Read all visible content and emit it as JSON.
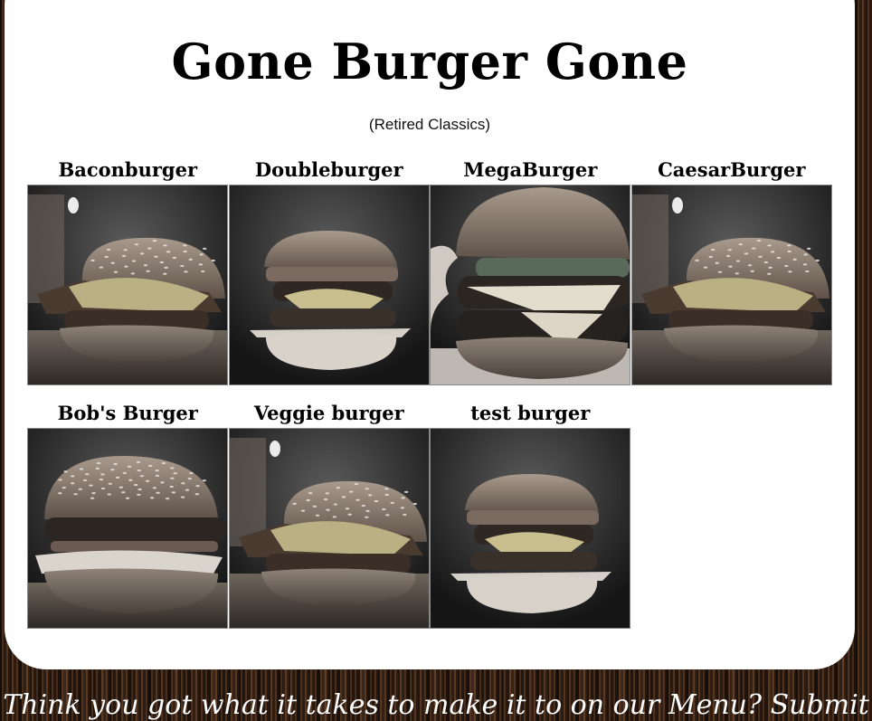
{
  "page": {
    "title": "Gone Burger Gone",
    "subtitle": "(Retired Classics)",
    "footer_text": "Think you got what it takes to make it to on our Menu? Submit"
  },
  "burgers": [
    {
      "name": "Baconburger",
      "image": "bacon-burger-photo"
    },
    {
      "name": "Doubleburger",
      "image": "double-burger-photo"
    },
    {
      "name": "MegaBurger",
      "image": "mega-burger-photo"
    },
    {
      "name": "CaesarBurger",
      "image": "caesar-burger-photo"
    },
    {
      "name": "Bob's Burger",
      "image": "bobs-burger-photo"
    },
    {
      "name": "Veggie burger",
      "image": "veggie-burger-photo"
    },
    {
      "name": "test burger",
      "image": "test-burger-photo"
    }
  ],
  "colors": {
    "card": "#ffffff",
    "background_wood": "#3a2418",
    "text": "#000000"
  }
}
